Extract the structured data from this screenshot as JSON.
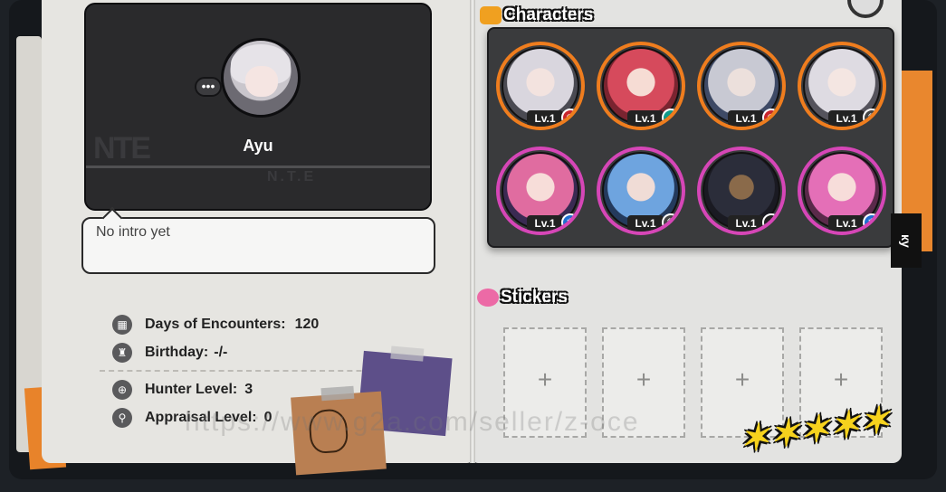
{
  "profile": {
    "name": "Ayu",
    "more_glyph": "•••",
    "card_logo": "NTE",
    "card_logo_sub": "N.T.E"
  },
  "intro": {
    "text": "No intro yet"
  },
  "stats": [
    {
      "label": "Days of Encounters:",
      "value": "120",
      "icon": "calendar-icon"
    },
    {
      "label": "Birthday:",
      "value": "-/-",
      "icon": "cake-icon"
    },
    {
      "label": "Hunter Level:",
      "value": "3",
      "icon": "crosshair-icon"
    },
    {
      "label": "Appraisal Level:",
      "value": "0",
      "icon": "magnifier-icon"
    }
  ],
  "sections": {
    "characters_title": "Characters",
    "stickers_title": "Stickers"
  },
  "characters": [
    {
      "level": "Lv.1",
      "ring": "orange",
      "element": "red",
      "hair": "#d9d6de"
    },
    {
      "level": "Lv.1",
      "ring": "orange",
      "element": "teal",
      "hair": "#d64a5c"
    },
    {
      "level": "Lv.1",
      "ring": "orange",
      "element": "red",
      "hair": "#c8c9d3"
    },
    {
      "level": "Lv.1",
      "ring": "orange",
      "element": "white",
      "hair": "#dedbe2"
    },
    {
      "level": "Lv.1",
      "ring": "pink",
      "element": "blue",
      "hair": "#e06ca0"
    },
    {
      "level": "Lv.1",
      "ring": "pink",
      "element": "white",
      "hair": "#6ea4df"
    },
    {
      "level": "Lv.1",
      "ring": "pink",
      "element": "yellow",
      "hair": "#2b2d3a"
    },
    {
      "level": "Lv.1",
      "ring": "pink",
      "element": "blue",
      "hair": "#e46fb7"
    }
  ],
  "sticker_slots": [
    "+",
    "+",
    "+",
    "+"
  ],
  "watermark": "https://www.g2a.com/seller/z-oce",
  "colors": {
    "ring_orange": "#ef7d1e",
    "ring_pink": "#d646b7",
    "accent_yellow": "#f6d21d"
  }
}
